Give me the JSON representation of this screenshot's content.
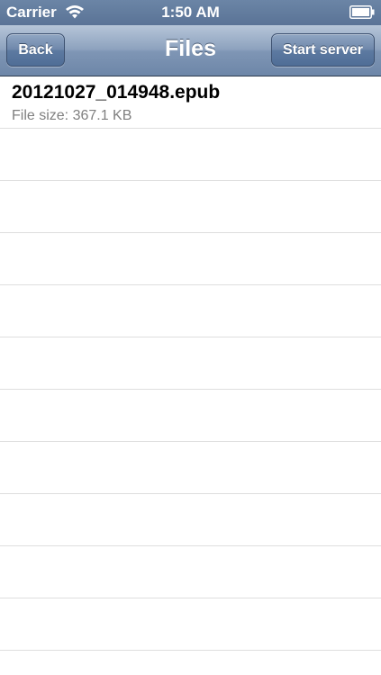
{
  "status_bar": {
    "carrier": "Carrier",
    "time": "1:50 AM",
    "icons": [
      "wifi-icon",
      "battery-icon"
    ]
  },
  "nav_bar": {
    "title": "Files",
    "back_label": "Back",
    "start_server_label": "Start server"
  },
  "files": [
    {
      "name": "20121027_014948.epub",
      "size_text": "File size: 367.1 KB"
    }
  ],
  "colors": {
    "nav_bar": "#7f96b5",
    "status_bar": "#5a7396",
    "separator": "#dedede",
    "subtitle_text": "#7f7f7f"
  }
}
